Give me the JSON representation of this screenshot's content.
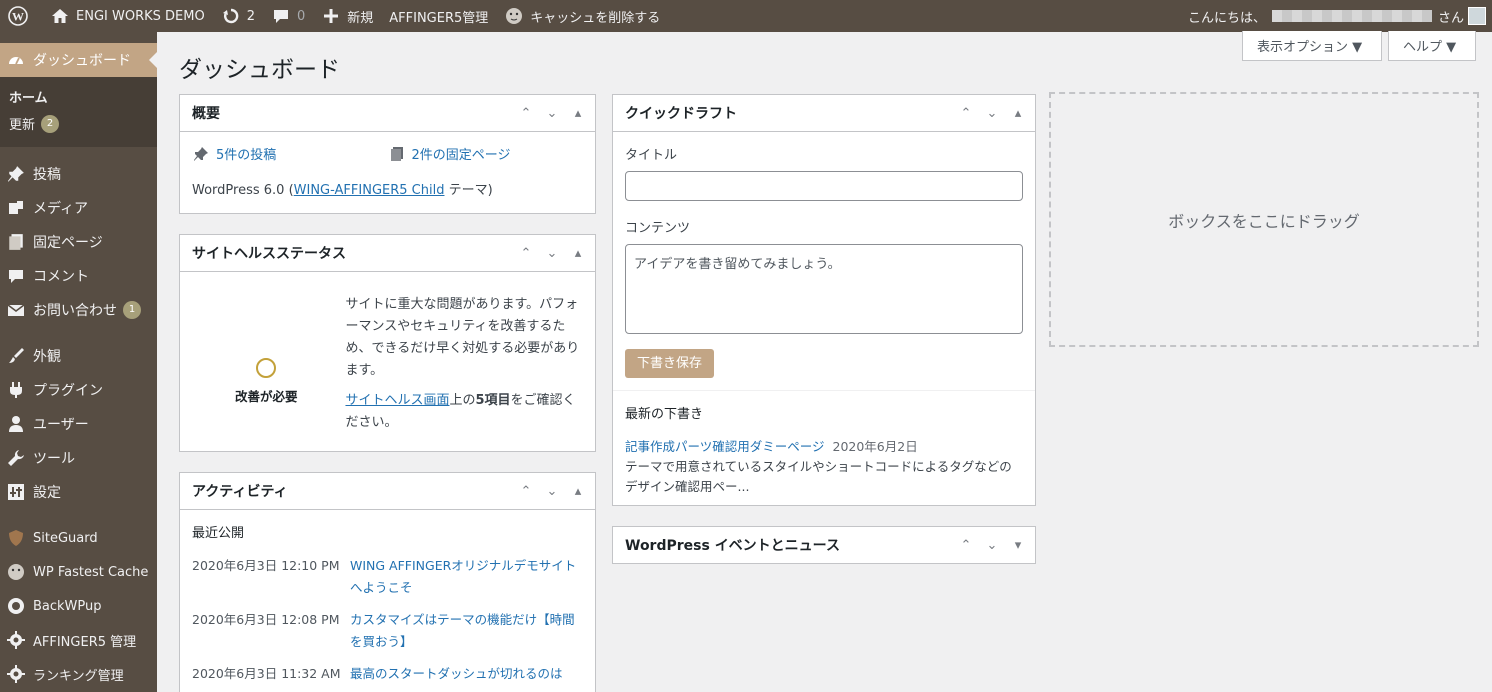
{
  "adminbar": {
    "site_name": "ENGI WORKS DEMO",
    "updates_count": "2",
    "comments_count": "0",
    "new_label": "新規",
    "affinger_label": "AFFINGER5管理",
    "cache_label": "キャッシュを削除する",
    "greeting": "こんにちは、",
    "greeting_suffix": "さん"
  },
  "sidebar": {
    "dashboard": "ダッシュボード",
    "home": "ホーム",
    "updates": "更新",
    "updates_badge": "2",
    "items": [
      {
        "label": "投稿",
        "icon": "pin-icon"
      },
      {
        "label": "メディア",
        "icon": "media-icon"
      },
      {
        "label": "固定ページ",
        "icon": "page-icon"
      },
      {
        "label": "コメント",
        "icon": "comment-icon"
      },
      {
        "label": "お問い合わせ",
        "icon": "mail-icon",
        "badge": "1"
      },
      {
        "label": "外観",
        "icon": "brush-icon"
      },
      {
        "label": "プラグイン",
        "icon": "plugin-icon"
      },
      {
        "label": "ユーザー",
        "icon": "user-icon"
      },
      {
        "label": "ツール",
        "icon": "wrench-icon"
      },
      {
        "label": "設定",
        "icon": "settings-icon"
      },
      {
        "label": "SiteGuard",
        "icon": "siteguard-icon"
      },
      {
        "label": "WP Fastest Cache",
        "icon": "cheetah-icon"
      },
      {
        "label": "BackWPup",
        "icon": "backwpup-icon"
      },
      {
        "label": "AFFINGER5 管理",
        "icon": "gear-icon"
      },
      {
        "label": "ランキング管理",
        "icon": "gear-icon"
      }
    ]
  },
  "screen_meta": {
    "options": "表示オプション ▼",
    "help": "ヘルプ ▼"
  },
  "page": {
    "title": "ダッシュボード"
  },
  "glance": {
    "title": "概要",
    "posts": "5件の投稿",
    "pages": "2件の固定ページ",
    "wp_version_prefix": "WordPress 6.0 (",
    "theme_link": "WING-AFFINGER5 Child",
    "theme_suffix": " テーマ)"
  },
  "health": {
    "title": "サイトヘルスステータス",
    "status": "改善が必要",
    "message": "サイトに重大な問題があります。パフォーマンスやセキュリティを改善するため、できるだけ早く対処する必要があります。",
    "link": "サイトヘルス画面",
    "link_suffix_1": "上の",
    "link_suffix_bold": "5項目",
    "link_suffix_2": "をご確認ください。"
  },
  "activity": {
    "title": "アクティビティ",
    "recent": "最近公開",
    "rows": [
      {
        "date": "2020年6月3日 12:10 PM",
        "post": "WING AFFINGERオリジナルデモサイトへようこそ"
      },
      {
        "date": "2020年6月3日 12:08 PM",
        "post": "カスタマイズはテーマの機能だけ【時間を買おう】"
      },
      {
        "date": "2020年6月3日 11:32 AM",
        "post": "最高のスタートダッシュが切れるのは"
      }
    ]
  },
  "quickdraft": {
    "title": "クイックドラフト",
    "title_label": "タイトル",
    "content_label": "コンテンツ",
    "content_placeholder": "アイデアを書き留めてみましょう。",
    "save_button": "下書き保存",
    "recent_drafts": "最新の下書き",
    "draft_title": "記事作成パーツ確認用ダミーページ",
    "draft_date": "2020年6月2日",
    "draft_excerpt": "テーマで用意されているスタイルやショートコードによるタグなどのデザイン確認用ペー..."
  },
  "events": {
    "title": "WordPress イベントとニュース"
  },
  "dropzone": {
    "label": "ボックスをここにドラッグ"
  }
}
